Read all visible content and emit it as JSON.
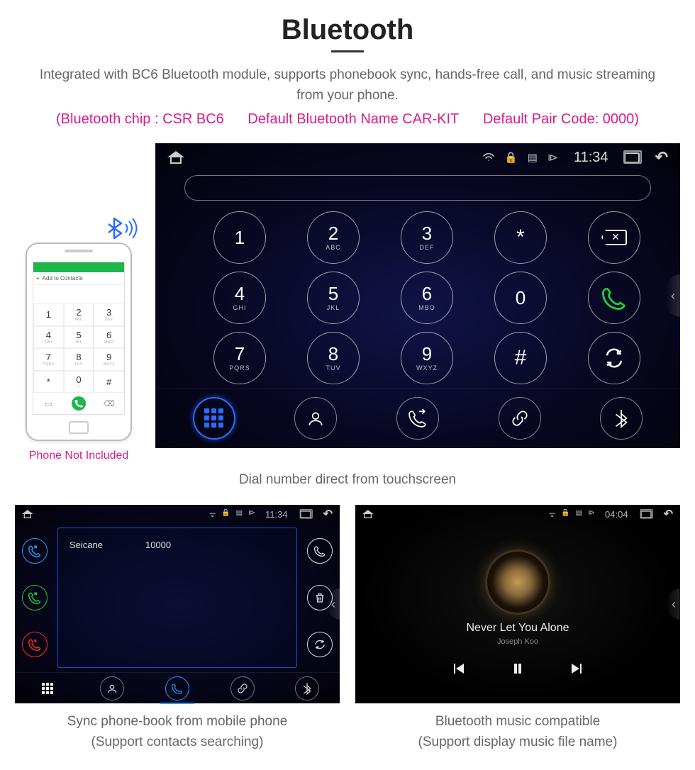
{
  "header": {
    "title": "Bluetooth",
    "description": "Integrated with BC6 Bluetooth module, supports phonebook sync, hands-free call, and music streaming from your phone.",
    "spec_chip": "(Bluetooth chip : CSR BC6",
    "spec_name": "Default Bluetooth Name CAR-KIT",
    "spec_code": "Default Pair Code: 0000)"
  },
  "phone": {
    "add_contacts": "Add to Contacts",
    "keys": [
      {
        "d": "1",
        "s": ""
      },
      {
        "d": "2",
        "s": "ABC"
      },
      {
        "d": "3",
        "s": "DEF"
      },
      {
        "d": "4",
        "s": "GHI"
      },
      {
        "d": "5",
        "s": "JKL"
      },
      {
        "d": "6",
        "s": "MNO"
      },
      {
        "d": "7",
        "s": "PQRS"
      },
      {
        "d": "8",
        "s": "TUV"
      },
      {
        "d": "9",
        "s": "WXYZ"
      },
      {
        "d": "*",
        "s": ""
      },
      {
        "d": "0",
        "s": "+"
      },
      {
        "d": "#",
        "s": ""
      }
    ],
    "note": "Phone Not Included"
  },
  "unit": {
    "status": {
      "time": "11:34"
    },
    "keys": [
      {
        "d": "1",
        "s": ""
      },
      {
        "d": "2",
        "s": "ABC"
      },
      {
        "d": "3",
        "s": "DEF"
      },
      {
        "type": "sym",
        "d": "*"
      },
      {
        "type": "delete"
      },
      {
        "d": "4",
        "s": "GHI"
      },
      {
        "d": "5",
        "s": "JKL"
      },
      {
        "d": "6",
        "s": "MBO"
      },
      {
        "d": "0",
        "s": ""
      },
      {
        "type": "call"
      },
      {
        "d": "7",
        "s": "PQRS"
      },
      {
        "d": "8",
        "s": "TUV"
      },
      {
        "d": "9",
        "s": "WXYZ"
      },
      {
        "type": "sym",
        "d": "#"
      },
      {
        "type": "swap"
      }
    ],
    "caption": "Dial number direct from touchscreen"
  },
  "contacts": {
    "status_time": "11:34",
    "row": {
      "name": "Seicane",
      "number": "10000"
    },
    "caption_l1": "Sync phone-book from mobile phone",
    "caption_l2": "(Support contacts searching)"
  },
  "music": {
    "status_time": "04:04",
    "track": "Never Let You Alone",
    "artist": "Joseph Koo",
    "caption_l1": "Bluetooth music compatible",
    "caption_l2": "(Support display music file name)"
  }
}
